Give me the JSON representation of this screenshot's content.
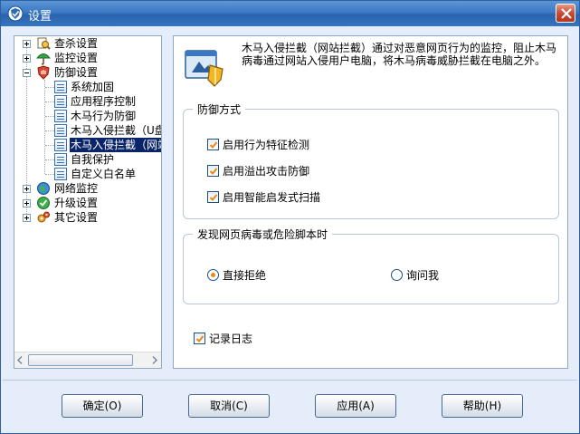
{
  "window": {
    "title": "设置"
  },
  "tree": {
    "categories": [
      {
        "label": "查杀设置",
        "icon": "scan-search-icon"
      },
      {
        "label": "监控设置",
        "icon": "umbrella-icon"
      },
      {
        "label": "防御设置",
        "icon": "shield-hand-icon"
      },
      {
        "label": "网络监控",
        "icon": "globe-icon"
      },
      {
        "label": "升级设置",
        "icon": "upgrade-check-icon"
      },
      {
        "label": "其它设置",
        "icon": "gears-icon"
      }
    ],
    "defense_children": [
      "系统加固",
      "应用程序控制",
      "木马行为防御",
      "木马入侵拦截（U盘",
      "木马入侵拦截（网站",
      "自我保护",
      "自定义白名单"
    ],
    "selected_index": 4
  },
  "main": {
    "description": "木马入侵拦截（网站拦截）通过对恶意网页行为的监控，阻止木马病毒通过网站入侵用户电脑，将木马病毒威胁拦截在电脑之外。",
    "defense_mode": {
      "title": "防御方式",
      "options": [
        {
          "label": "启用行为特征检测",
          "checked": true
        },
        {
          "label": "启用溢出攻击防御",
          "checked": true
        },
        {
          "label": "启用智能启发式扫描",
          "checked": true
        }
      ]
    },
    "found_virus": {
      "title": "发现网页病毒或危险脚本时",
      "options": [
        {
          "label": "直接拒绝",
          "selected": true
        },
        {
          "label": "询问我",
          "selected": false
        }
      ]
    },
    "log": {
      "label": "记录日志",
      "checked": true
    }
  },
  "buttons": {
    "ok": "确定(O)",
    "cancel": "取消(C)",
    "apply": "应用(A)",
    "help": "帮助(H)"
  },
  "colors": {
    "title_bar": "#3c79c4",
    "selection": "#0a246a",
    "check_mark": "#e88a17"
  }
}
